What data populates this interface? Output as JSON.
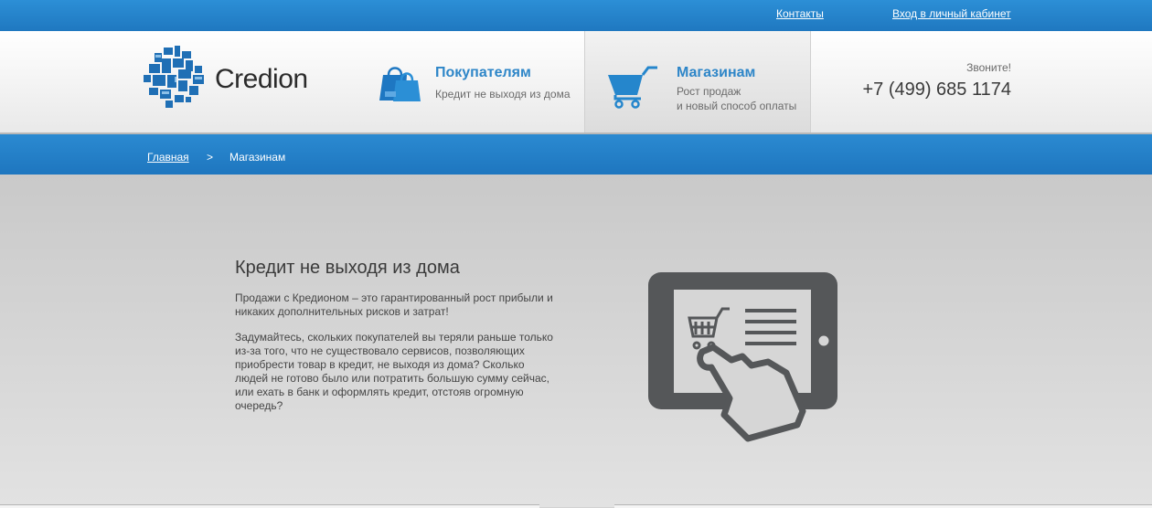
{
  "topbar": {
    "contacts": "Контакты",
    "login": "Вход в личный кабинет"
  },
  "header": {
    "logo_text": "Credion",
    "buyers": {
      "title": "Покупателям",
      "subtitle": "Кредит не выходя из дома"
    },
    "shops": {
      "title": "Магазинам",
      "subtitle_line1": "Рост продаж",
      "subtitle_line2": "и новый способ оплаты"
    },
    "call_label": "Звоните!",
    "phone": "+7 (499) 685 1174"
  },
  "breadcrumb": {
    "home": "Главная",
    "separator": ">",
    "current": "Магазинам"
  },
  "content": {
    "headline": "Кредит не выходя из дома",
    "paragraph1": "Продажи с Кредионом – это гарантированный рост прибыли и никаких дополнительных рисков и затрат!",
    "paragraph2": "Задумайтесь, скольких покупателей вы теряли раньше только из-за того, что не существовало сервисов, позволяющих приобрести товар в кредит, не выходя из дома? Сколько людей не готово было или потратить большую сумму сейчас, или ехать в банк и оформлять кредит, отстояв огромную очередь?"
  },
  "icons": {
    "logo": "credion-logo-icon",
    "buyers": "shopping-bags-icon",
    "shops": "shopping-cart-icon",
    "illustration": "tablet-cart-hand-icon"
  },
  "colors": {
    "primary_blue": "#2586cc",
    "nav_title": "#2e86c8",
    "illustration_gray": "#555759"
  }
}
